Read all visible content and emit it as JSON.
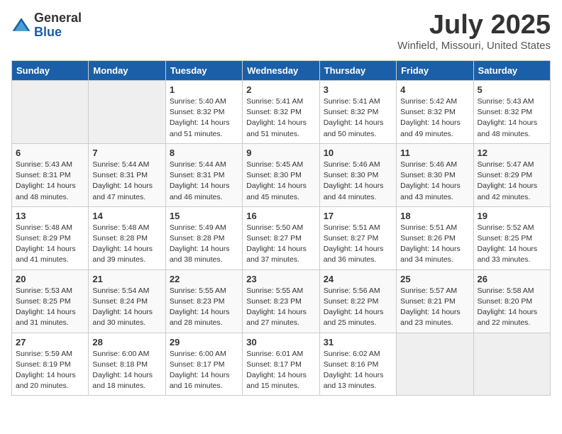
{
  "logo": {
    "general": "General",
    "blue": "Blue"
  },
  "title": "July 2025",
  "location": "Winfield, Missouri, United States",
  "days_of_week": [
    "Sunday",
    "Monday",
    "Tuesday",
    "Wednesday",
    "Thursday",
    "Friday",
    "Saturday"
  ],
  "weeks": [
    [
      {
        "day": "",
        "empty": true
      },
      {
        "day": "",
        "empty": true
      },
      {
        "day": "1",
        "sunrise": "Sunrise: 5:40 AM",
        "sunset": "Sunset: 8:32 PM",
        "daylight": "Daylight: 14 hours and 51 minutes."
      },
      {
        "day": "2",
        "sunrise": "Sunrise: 5:41 AM",
        "sunset": "Sunset: 8:32 PM",
        "daylight": "Daylight: 14 hours and 51 minutes."
      },
      {
        "day": "3",
        "sunrise": "Sunrise: 5:41 AM",
        "sunset": "Sunset: 8:32 PM",
        "daylight": "Daylight: 14 hours and 50 minutes."
      },
      {
        "day": "4",
        "sunrise": "Sunrise: 5:42 AM",
        "sunset": "Sunset: 8:32 PM",
        "daylight": "Daylight: 14 hours and 49 minutes."
      },
      {
        "day": "5",
        "sunrise": "Sunrise: 5:43 AM",
        "sunset": "Sunset: 8:32 PM",
        "daylight": "Daylight: 14 hours and 48 minutes."
      }
    ],
    [
      {
        "day": "6",
        "sunrise": "Sunrise: 5:43 AM",
        "sunset": "Sunset: 8:31 PM",
        "daylight": "Daylight: 14 hours and 48 minutes."
      },
      {
        "day": "7",
        "sunrise": "Sunrise: 5:44 AM",
        "sunset": "Sunset: 8:31 PM",
        "daylight": "Daylight: 14 hours and 47 minutes."
      },
      {
        "day": "8",
        "sunrise": "Sunrise: 5:44 AM",
        "sunset": "Sunset: 8:31 PM",
        "daylight": "Daylight: 14 hours and 46 minutes."
      },
      {
        "day": "9",
        "sunrise": "Sunrise: 5:45 AM",
        "sunset": "Sunset: 8:30 PM",
        "daylight": "Daylight: 14 hours and 45 minutes."
      },
      {
        "day": "10",
        "sunrise": "Sunrise: 5:46 AM",
        "sunset": "Sunset: 8:30 PM",
        "daylight": "Daylight: 14 hours and 44 minutes."
      },
      {
        "day": "11",
        "sunrise": "Sunrise: 5:46 AM",
        "sunset": "Sunset: 8:30 PM",
        "daylight": "Daylight: 14 hours and 43 minutes."
      },
      {
        "day": "12",
        "sunrise": "Sunrise: 5:47 AM",
        "sunset": "Sunset: 8:29 PM",
        "daylight": "Daylight: 14 hours and 42 minutes."
      }
    ],
    [
      {
        "day": "13",
        "sunrise": "Sunrise: 5:48 AM",
        "sunset": "Sunset: 8:29 PM",
        "daylight": "Daylight: 14 hours and 41 minutes."
      },
      {
        "day": "14",
        "sunrise": "Sunrise: 5:48 AM",
        "sunset": "Sunset: 8:28 PM",
        "daylight": "Daylight: 14 hours and 39 minutes."
      },
      {
        "day": "15",
        "sunrise": "Sunrise: 5:49 AM",
        "sunset": "Sunset: 8:28 PM",
        "daylight": "Daylight: 14 hours and 38 minutes."
      },
      {
        "day": "16",
        "sunrise": "Sunrise: 5:50 AM",
        "sunset": "Sunset: 8:27 PM",
        "daylight": "Daylight: 14 hours and 37 minutes."
      },
      {
        "day": "17",
        "sunrise": "Sunrise: 5:51 AM",
        "sunset": "Sunset: 8:27 PM",
        "daylight": "Daylight: 14 hours and 36 minutes."
      },
      {
        "day": "18",
        "sunrise": "Sunrise: 5:51 AM",
        "sunset": "Sunset: 8:26 PM",
        "daylight": "Daylight: 14 hours and 34 minutes."
      },
      {
        "day": "19",
        "sunrise": "Sunrise: 5:52 AM",
        "sunset": "Sunset: 8:25 PM",
        "daylight": "Daylight: 14 hours and 33 minutes."
      }
    ],
    [
      {
        "day": "20",
        "sunrise": "Sunrise: 5:53 AM",
        "sunset": "Sunset: 8:25 PM",
        "daylight": "Daylight: 14 hours and 31 minutes."
      },
      {
        "day": "21",
        "sunrise": "Sunrise: 5:54 AM",
        "sunset": "Sunset: 8:24 PM",
        "daylight": "Daylight: 14 hours and 30 minutes."
      },
      {
        "day": "22",
        "sunrise": "Sunrise: 5:55 AM",
        "sunset": "Sunset: 8:23 PM",
        "daylight": "Daylight: 14 hours and 28 minutes."
      },
      {
        "day": "23",
        "sunrise": "Sunrise: 5:55 AM",
        "sunset": "Sunset: 8:23 PM",
        "daylight": "Daylight: 14 hours and 27 minutes."
      },
      {
        "day": "24",
        "sunrise": "Sunrise: 5:56 AM",
        "sunset": "Sunset: 8:22 PM",
        "daylight": "Daylight: 14 hours and 25 minutes."
      },
      {
        "day": "25",
        "sunrise": "Sunrise: 5:57 AM",
        "sunset": "Sunset: 8:21 PM",
        "daylight": "Daylight: 14 hours and 23 minutes."
      },
      {
        "day": "26",
        "sunrise": "Sunrise: 5:58 AM",
        "sunset": "Sunset: 8:20 PM",
        "daylight": "Daylight: 14 hours and 22 minutes."
      }
    ],
    [
      {
        "day": "27",
        "sunrise": "Sunrise: 5:59 AM",
        "sunset": "Sunset: 8:19 PM",
        "daylight": "Daylight: 14 hours and 20 minutes."
      },
      {
        "day": "28",
        "sunrise": "Sunrise: 6:00 AM",
        "sunset": "Sunset: 8:18 PM",
        "daylight": "Daylight: 14 hours and 18 minutes."
      },
      {
        "day": "29",
        "sunrise": "Sunrise: 6:00 AM",
        "sunset": "Sunset: 8:17 PM",
        "daylight": "Daylight: 14 hours and 16 minutes."
      },
      {
        "day": "30",
        "sunrise": "Sunrise: 6:01 AM",
        "sunset": "Sunset: 8:17 PM",
        "daylight": "Daylight: 14 hours and 15 minutes."
      },
      {
        "day": "31",
        "sunrise": "Sunrise: 6:02 AM",
        "sunset": "Sunset: 8:16 PM",
        "daylight": "Daylight: 14 hours and 13 minutes."
      },
      {
        "day": "",
        "empty": true
      },
      {
        "day": "",
        "empty": true
      }
    ]
  ]
}
